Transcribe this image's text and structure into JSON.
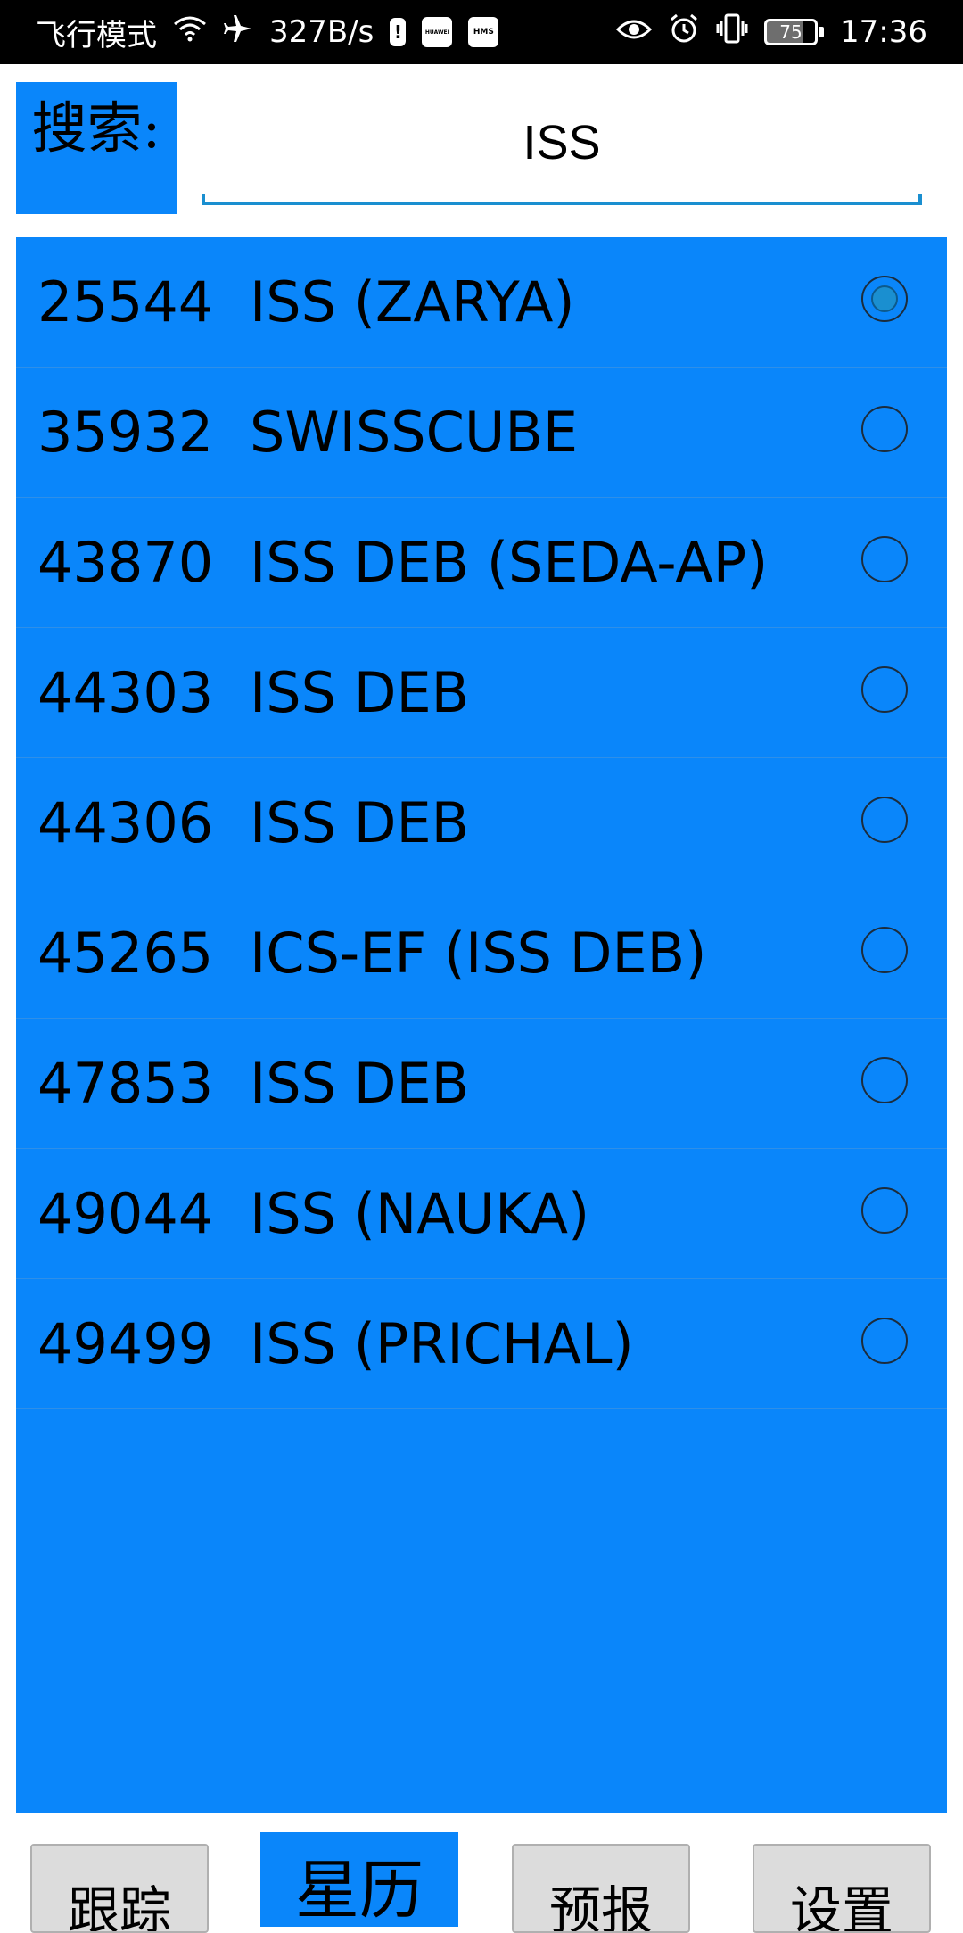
{
  "status_bar": {
    "airplane_mode_text": "飞行模式",
    "wifi_icon": "wifi-icon",
    "airplane_icon": "airplane-icon",
    "network_speed": "327B/s",
    "notif_1": "!",
    "notif_2": "HUAWEI",
    "notif_3": "HMS",
    "eye_icon": "eye-icon",
    "alarm_icon": "alarm-icon",
    "vibrate_icon": "vibrate-icon",
    "battery_level": "75",
    "time": "17:36"
  },
  "search": {
    "label": "搜索:",
    "value": "ISS"
  },
  "satellites": [
    {
      "id": "25544",
      "name": "ISS (ZARYA)",
      "selected": true
    },
    {
      "id": "35932",
      "name": "SWISSCUBE",
      "selected": false
    },
    {
      "id": "43870",
      "name": "ISS DEB (SEDA-AP)",
      "selected": false
    },
    {
      "id": "44303",
      "name": "ISS DEB",
      "selected": false
    },
    {
      "id": "44306",
      "name": "ISS DEB",
      "selected": false
    },
    {
      "id": "45265",
      "name": "ICS-EF (ISS DEB)",
      "selected": false
    },
    {
      "id": "47853",
      "name": "ISS DEB",
      "selected": false
    },
    {
      "id": "49044",
      "name": "ISS (NAUKA)",
      "selected": false
    },
    {
      "id": "49499",
      "name": "ISS (PRICHAL)",
      "selected": false
    }
  ],
  "bottom_nav": {
    "track": "跟踪",
    "ephemeris": "星历",
    "forecast": "预报",
    "settings": "设置"
  },
  "colors": {
    "accent_blue": "#0a86fa",
    "underline": "#1a8fd0"
  }
}
